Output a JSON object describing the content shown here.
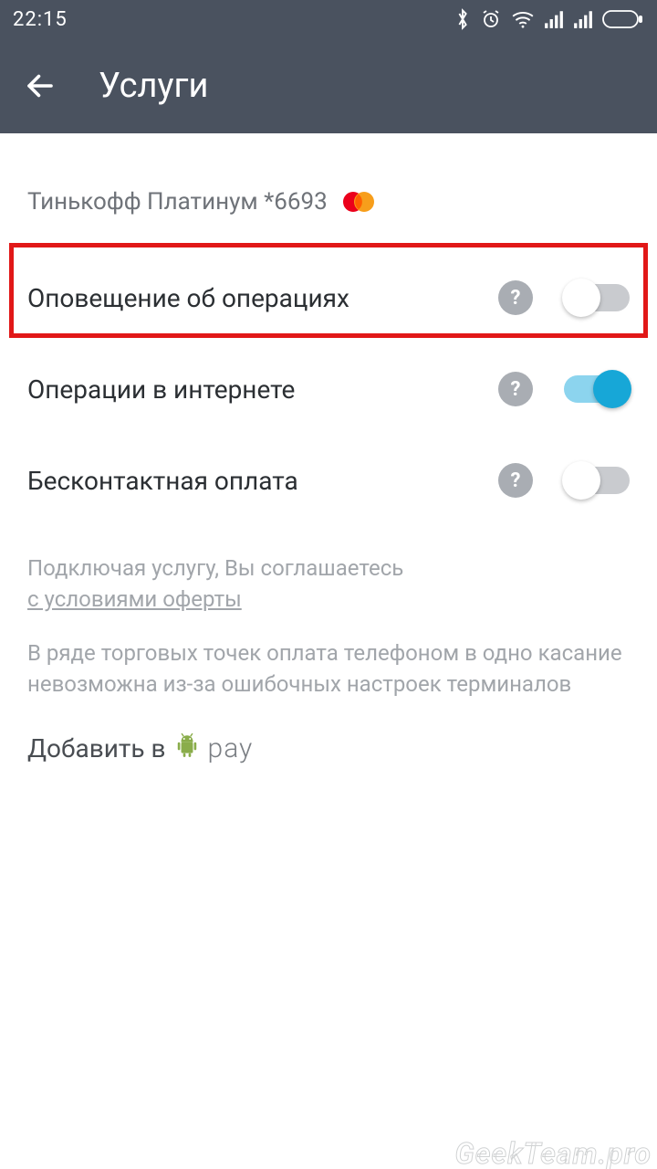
{
  "status": {
    "time": "22:15"
  },
  "header": {
    "title": "Услуги"
  },
  "card": {
    "name": "Тинькофф Платинум *6693"
  },
  "settings": [
    {
      "label": "Оповещение об операциях",
      "on": false,
      "highlight": true
    },
    {
      "label": "Операции в интернете",
      "on": true,
      "highlight": false
    },
    {
      "label": "Бесконтактная оплата",
      "on": false,
      "highlight": false
    }
  ],
  "info": {
    "line1": "Подключая услугу, Вы соглашаетесь",
    "link": "с условиями оферты",
    "paragraph": "В ряде торговых точек оплата телефоном в одно касание невозможна из-за ошибочных настроек терминалов"
  },
  "addpay": {
    "prefix": "Добавить в",
    "brand": "pay"
  },
  "watermark": "GeekTeam.pro"
}
